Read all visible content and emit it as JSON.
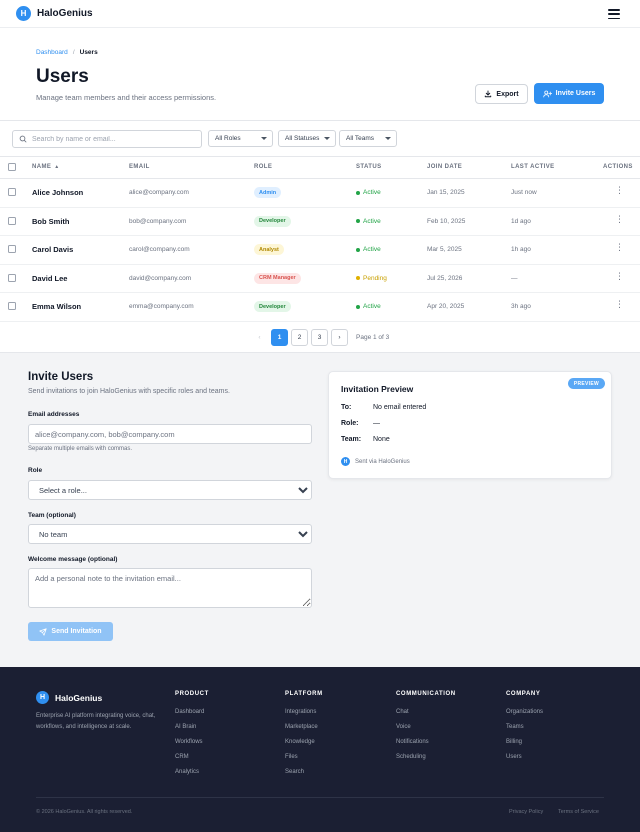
{
  "app": {
    "logo_letter": "H",
    "name": "HaloGenius"
  },
  "header": {
    "breadcrumb": {
      "parent": "Dashboard",
      "separator": "/",
      "current": "Users"
    },
    "title": "Users",
    "subtitle": "Manage team members and their access permissions.",
    "export_label": "Export",
    "invite_label": "Invite Users"
  },
  "filters": {
    "search_placeholder": "Search by name or email...",
    "roles": "All Roles",
    "statuses": "All Statuses",
    "teams": "All Teams"
  },
  "table": {
    "columns": [
      "NAME",
      "EMAIL",
      "ROLE",
      "STATUS",
      "JOIN DATE",
      "LAST ACTIVE",
      "ACTIONS"
    ],
    "sort_indicator": "▲",
    "actions_glyph": "⋮",
    "rows": [
      {
        "name": "Alice Johnson",
        "email": "alice@company.com",
        "role": "Admin",
        "status": "Active",
        "join_date": "Jan 15, 2025",
        "last_active": "Just now"
      },
      {
        "name": "Bob Smith",
        "email": "bob@company.com",
        "role": "Developer",
        "status": "Active",
        "join_date": "Feb 10, 2025",
        "last_active": "1d ago"
      },
      {
        "name": "Carol Davis",
        "email": "carol@company.com",
        "role": "Analyst",
        "status": "Active",
        "join_date": "Mar 5, 2025",
        "last_active": "1h ago"
      },
      {
        "name": "David Lee",
        "email": "david@company.com",
        "role": "CRM Manager",
        "status": "Pending",
        "join_date": "Jul 25, 2026",
        "last_active": "—"
      },
      {
        "name": "Emma Wilson",
        "email": "emma@company.com",
        "role": "Developer",
        "status": "Active",
        "join_date": "Apr 20, 2025",
        "last_active": "3h ago"
      }
    ]
  },
  "pagination": {
    "prev": "‹",
    "next": "›",
    "pages": [
      "1",
      "2",
      "3"
    ],
    "current_page": "1",
    "info": "Page 1 of 3"
  },
  "invite": {
    "title": "Invite Users",
    "subtitle": "Send invitations to join HaloGenius with specific roles and teams.",
    "emails_label": "Email addresses",
    "emails_placeholder": "alice@company.com, bob@company.com",
    "emails_helper": "Separate multiple emails with commas.",
    "role_label": "Role",
    "role_selected": "Select a role...",
    "team_label": "Team (optional)",
    "team_selected": "No team",
    "message_label": "Welcome message (optional)",
    "message_placeholder": "Add a personal note to the invitation email...",
    "send_label": "Send Invitation"
  },
  "preview": {
    "badge": "PREVIEW",
    "title": "Invitation Preview",
    "to_label": "To:",
    "to_value": "No email entered",
    "role_label": "Role:",
    "role_value": "—",
    "team_label": "Team:",
    "team_value": "None",
    "footer": "Sent via HaloGenius"
  },
  "footer": {
    "brand": "HaloGenius",
    "description": "Enterprise AI platform integrating voice, chat, workflows, and intelligence at scale.",
    "columns": [
      {
        "title": "PRODUCT",
        "links": [
          "Dashboard",
          "AI Brain",
          "Workflows",
          "CRM",
          "Analytics"
        ]
      },
      {
        "title": "PLATFORM",
        "links": [
          "Integrations",
          "Marketplace",
          "Knowledge",
          "Files",
          "Search"
        ]
      },
      {
        "title": "COMMUNICATION",
        "links": [
          "Chat",
          "Voice",
          "Notifications",
          "Scheduling"
        ]
      },
      {
        "title": "COMPANY",
        "links": [
          "Organizations",
          "Teams",
          "Billing",
          "Users"
        ]
      }
    ],
    "copyright": "© 2026 HaloGenius. All rights reserved.",
    "privacy": "Privacy Policy",
    "terms": "Terms of Service"
  },
  "colors": {
    "primary": "#2f8ff0",
    "active_status": "#22a447",
    "pending_status": "#e0b000",
    "footer_bg": "#1b1f33"
  }
}
